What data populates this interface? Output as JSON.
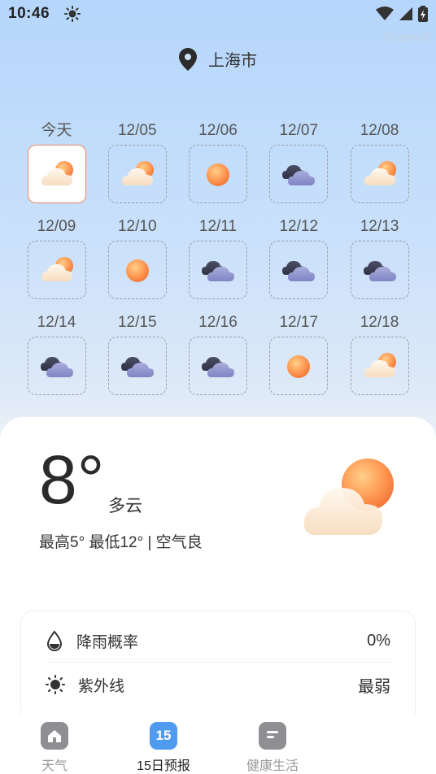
{
  "status_bar": {
    "time": "10:46"
  },
  "app_id": "ID:6bf845",
  "location": {
    "city": "上海市"
  },
  "forecast_days": [
    {
      "label": "今天",
      "weather": "partly-cloudy",
      "selected": true
    },
    {
      "label": "12/05",
      "weather": "partly-cloudy"
    },
    {
      "label": "12/06",
      "weather": "sunny"
    },
    {
      "label": "12/07",
      "weather": "cloudy"
    },
    {
      "label": "12/08",
      "weather": "partly-cloudy"
    },
    {
      "label": "12/09",
      "weather": "partly-cloudy"
    },
    {
      "label": "12/10",
      "weather": "sunny"
    },
    {
      "label": "12/11",
      "weather": "cloudy"
    },
    {
      "label": "12/12",
      "weather": "cloudy"
    },
    {
      "label": "12/13",
      "weather": "cloudy"
    },
    {
      "label": "12/14",
      "weather": "cloudy"
    },
    {
      "label": "12/15",
      "weather": "cloudy"
    },
    {
      "label": "12/16",
      "weather": "cloudy"
    },
    {
      "label": "12/17",
      "weather": "sunny"
    },
    {
      "label": "12/18",
      "weather": "partly-cloudy"
    }
  ],
  "current": {
    "temperature": "8°",
    "condition": "多云",
    "range_text": "最高5° 最低12° | 空气良"
  },
  "details": [
    {
      "label": "降雨概率",
      "value": "0%",
      "icon": "water-drop-icon"
    },
    {
      "label": "紫外线",
      "value": "最弱",
      "icon": "sun-icon"
    }
  ],
  "tabs": [
    {
      "label": "天气",
      "icon": "home-icon",
      "active": false
    },
    {
      "label": "15日预报",
      "icon": "calendar-15-icon",
      "badge": "15",
      "active": true
    },
    {
      "label": "健康生活",
      "icon": "notes-icon",
      "active": false
    }
  ],
  "colors": {
    "accent_selected": "#f08a5d",
    "tab_active_icon": "#4f9bf0",
    "tab_inactive_icon": "#8e8e93"
  }
}
